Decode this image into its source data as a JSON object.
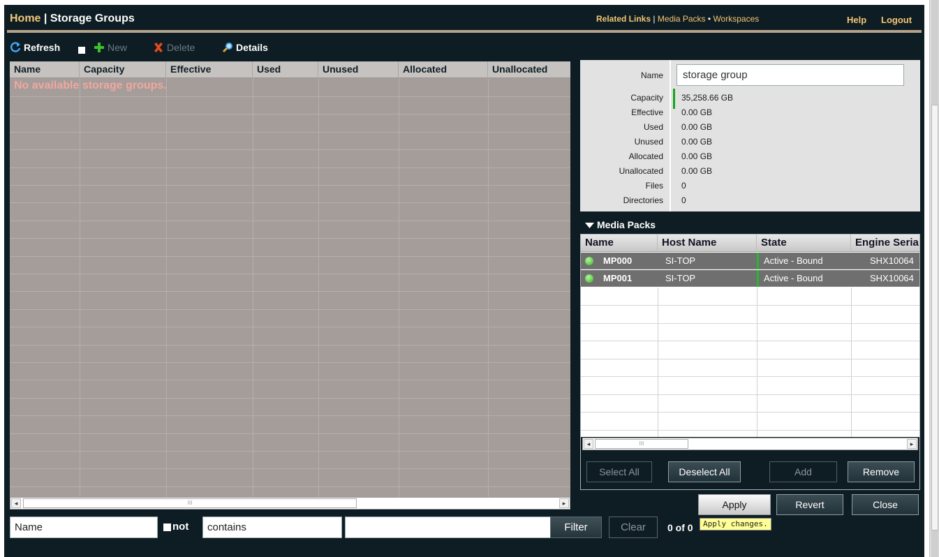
{
  "header": {
    "home": "Home",
    "separator": "|",
    "title": "Storage Groups",
    "related_label": "Related Links",
    "related_sep": "|",
    "media_packs": "Media Packs",
    "bullet": "•",
    "workspaces": "Workspaces",
    "help": "Help",
    "logout": "Logout"
  },
  "toolbar": {
    "refresh": "Refresh",
    "new": "New",
    "delete": "Delete",
    "details": "Details"
  },
  "grid": {
    "columns": [
      "Name",
      "Capacity",
      "Effective",
      "Used",
      "Unused",
      "Allocated",
      "Unallocated"
    ],
    "empty_message": "No available storage groups."
  },
  "filter": {
    "field": "Name",
    "not_label": "not",
    "operator": "contains",
    "value": "",
    "filter_button": "Filter",
    "clear_button": "Clear",
    "count": "0 of 0"
  },
  "details": {
    "name_label": "Name",
    "name_value": "storage group",
    "fields": [
      {
        "label": "Capacity",
        "value": "35,258.66 GB"
      },
      {
        "label": "Effective",
        "value": "0.00 GB"
      },
      {
        "label": "Used",
        "value": "0.00 GB"
      },
      {
        "label": "Unused",
        "value": "0.00 GB"
      },
      {
        "label": "Allocated",
        "value": "0.00 GB"
      },
      {
        "label": "Unallocated",
        "value": "0.00 GB"
      },
      {
        "label": "Files",
        "value": "0"
      },
      {
        "label": "Directories",
        "value": "0"
      }
    ]
  },
  "media_packs": {
    "title": "Media Packs",
    "columns": [
      "Name",
      "Host Name",
      "State",
      "Engine Seria"
    ],
    "rows": [
      {
        "name": "MP000",
        "host": "SI-TOP",
        "state": "Active - Bound",
        "serial": "SHX10064"
      },
      {
        "name": "MP001",
        "host": "SI-TOP",
        "state": "Active - Bound",
        "serial": "SHX10064"
      }
    ],
    "select_all": "Select All",
    "deselect_all": "Deselect All",
    "add": "Add",
    "remove": "Remove"
  },
  "actions": {
    "apply": "Apply",
    "revert": "Revert",
    "close": "Close",
    "tooltip": "Apply changes."
  },
  "colors": {
    "background": "#0e1d24",
    "accent": "#f3c672",
    "grid": "#a49d99",
    "status_active": "#37b41f"
  }
}
